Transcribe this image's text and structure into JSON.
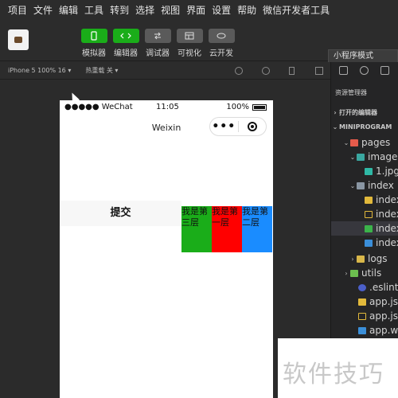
{
  "menubar": {
    "items": [
      "项目",
      "文件",
      "编辑",
      "工具",
      "转到",
      "选择",
      "视图",
      "界面",
      "设置",
      "帮助",
      "微信开发者工具"
    ]
  },
  "toolbar": {
    "tools": [
      {
        "label": "模拟器",
        "icon": "phone-icon",
        "active": true
      },
      {
        "label": "编辑器",
        "icon": "code-icon",
        "active": true
      },
      {
        "label": "调试器",
        "icon": "debug-icon",
        "active": false
      },
      {
        "label": "可视化",
        "icon": "layout-icon",
        "active": false
      },
      {
        "label": "云开发",
        "icon": "cloud-icon",
        "active": false
      }
    ],
    "mode": "小程序模式",
    "colors": {
      "active": "#1aad19",
      "inactive": "#5a5a5a"
    }
  },
  "subbar": {
    "device": "iPhone 5 100% 16 ▾",
    "hot_reload": "热重载 关 ▾"
  },
  "phone": {
    "status": {
      "carrier": "●●●●● WeChat",
      "time": "11:05",
      "battery": "100%"
    },
    "nav_title": "Weixin",
    "capsule_dots": "•••",
    "submit_label": "提交",
    "layers": [
      {
        "text": "我是第三层",
        "color": "#1aad19"
      },
      {
        "text": "我是第一层",
        "color": "#ff0000"
      },
      {
        "text": "我是第二层",
        "color": "#1a8cff"
      }
    ]
  },
  "explorer": {
    "title": "资源管理器",
    "rows": [
      {
        "label": "打开的编辑器",
        "arrow": "›",
        "icon": "",
        "small": true
      },
      {
        "label": "MINIPROGRAM",
        "arrow": "⌄",
        "icon": "",
        "small": true
      },
      {
        "label": "pages",
        "arrow": "⌄",
        "icon": "folder-red"
      },
      {
        "label": "images",
        "arrow": "⌄",
        "icon": "folder-teal"
      },
      {
        "label": "1.jpg",
        "arrow": "",
        "icon": "image-file"
      },
      {
        "label": "index",
        "arrow": "⌄",
        "icon": "folder-gray"
      },
      {
        "label": "index.js",
        "arrow": "",
        "icon": "js-file"
      },
      {
        "label": "index.json",
        "arrow": "",
        "icon": "json-file"
      },
      {
        "label": "index.wxml",
        "arrow": "",
        "icon": "wxml-file",
        "selected": true
      },
      {
        "label": "index.wxss",
        "arrow": "",
        "icon": "wxss-file"
      },
      {
        "label": "logs",
        "arrow": "›",
        "icon": "folder-yellow"
      },
      {
        "label": "utils",
        "arrow": "›",
        "icon": "folder-green"
      },
      {
        "label": ".eslintrc.js",
        "arrow": "",
        "icon": "eslint-file"
      },
      {
        "label": "app.js",
        "arrow": "",
        "icon": "js-file"
      },
      {
        "label": "app.json",
        "arrow": "",
        "icon": "json-file"
      },
      {
        "label": "app.wxss",
        "arrow": "",
        "icon": "wxss-file"
      }
    ]
  },
  "watermark": "软件技巧"
}
